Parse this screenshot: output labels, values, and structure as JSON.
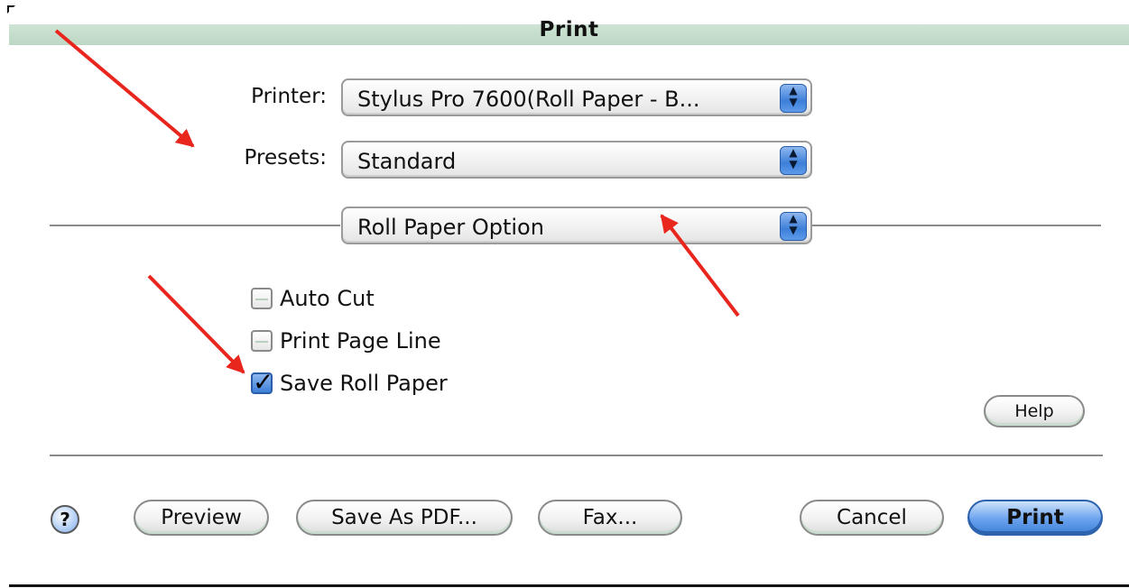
{
  "window": {
    "title": "Print"
  },
  "printer": {
    "label": "Printer:",
    "value": "Stylus Pro 7600(Roll Paper - B..."
  },
  "presets": {
    "label": "Presets:",
    "value": "Standard"
  },
  "panel": {
    "value": "Roll Paper Option"
  },
  "options": [
    {
      "label": "Auto Cut",
      "checked": false
    },
    {
      "label": "Print Page Line",
      "checked": false
    },
    {
      "label": "Save Roll Paper",
      "checked": true
    }
  ],
  "buttons": {
    "help": "Help",
    "help_circle": "?",
    "preview": "Preview",
    "save_pdf": "Save As PDF...",
    "fax": "Fax...",
    "cancel": "Cancel",
    "print": "Print"
  },
  "icons": {
    "stepper": "up-down-arrows-icon",
    "check": "checkmark-icon",
    "annotation": "red-arrow-annotation"
  },
  "colors": {
    "accent": "#3d7fd9",
    "annotation": "#e8261e",
    "titlebar": "#bcd8c4"
  }
}
